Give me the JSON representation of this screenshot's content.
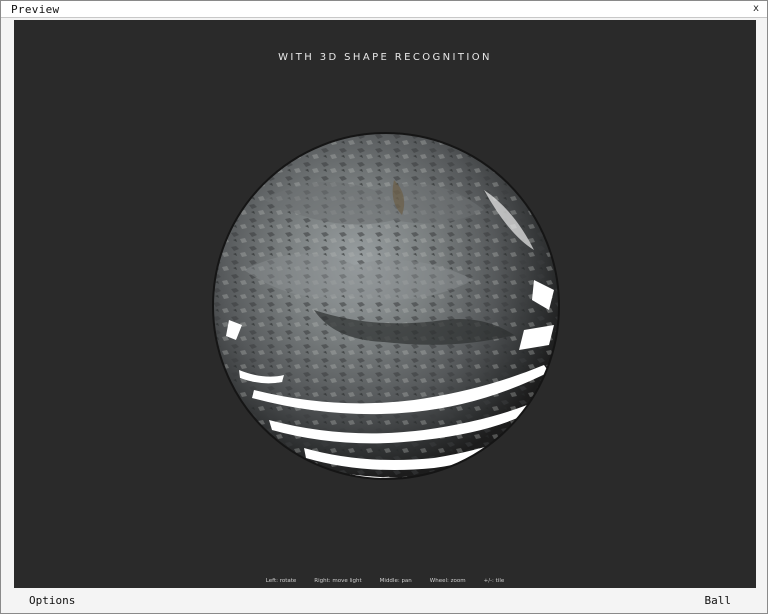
{
  "window": {
    "title": "Preview",
    "close_label": "x"
  },
  "viewport": {
    "headline": "WITH 3d SHAPE RECOGNITION",
    "background_color": "#2a2a2a",
    "hints": [
      "Left: rotate",
      "Right: move light",
      "Middle: pan",
      "Wheel: zoom",
      "+/-: tile"
    ]
  },
  "bottom_bar": {
    "options_label": "Options",
    "shape_label": "Ball"
  },
  "preview_object": {
    "shape": "sphere",
    "material": "rock texture"
  }
}
